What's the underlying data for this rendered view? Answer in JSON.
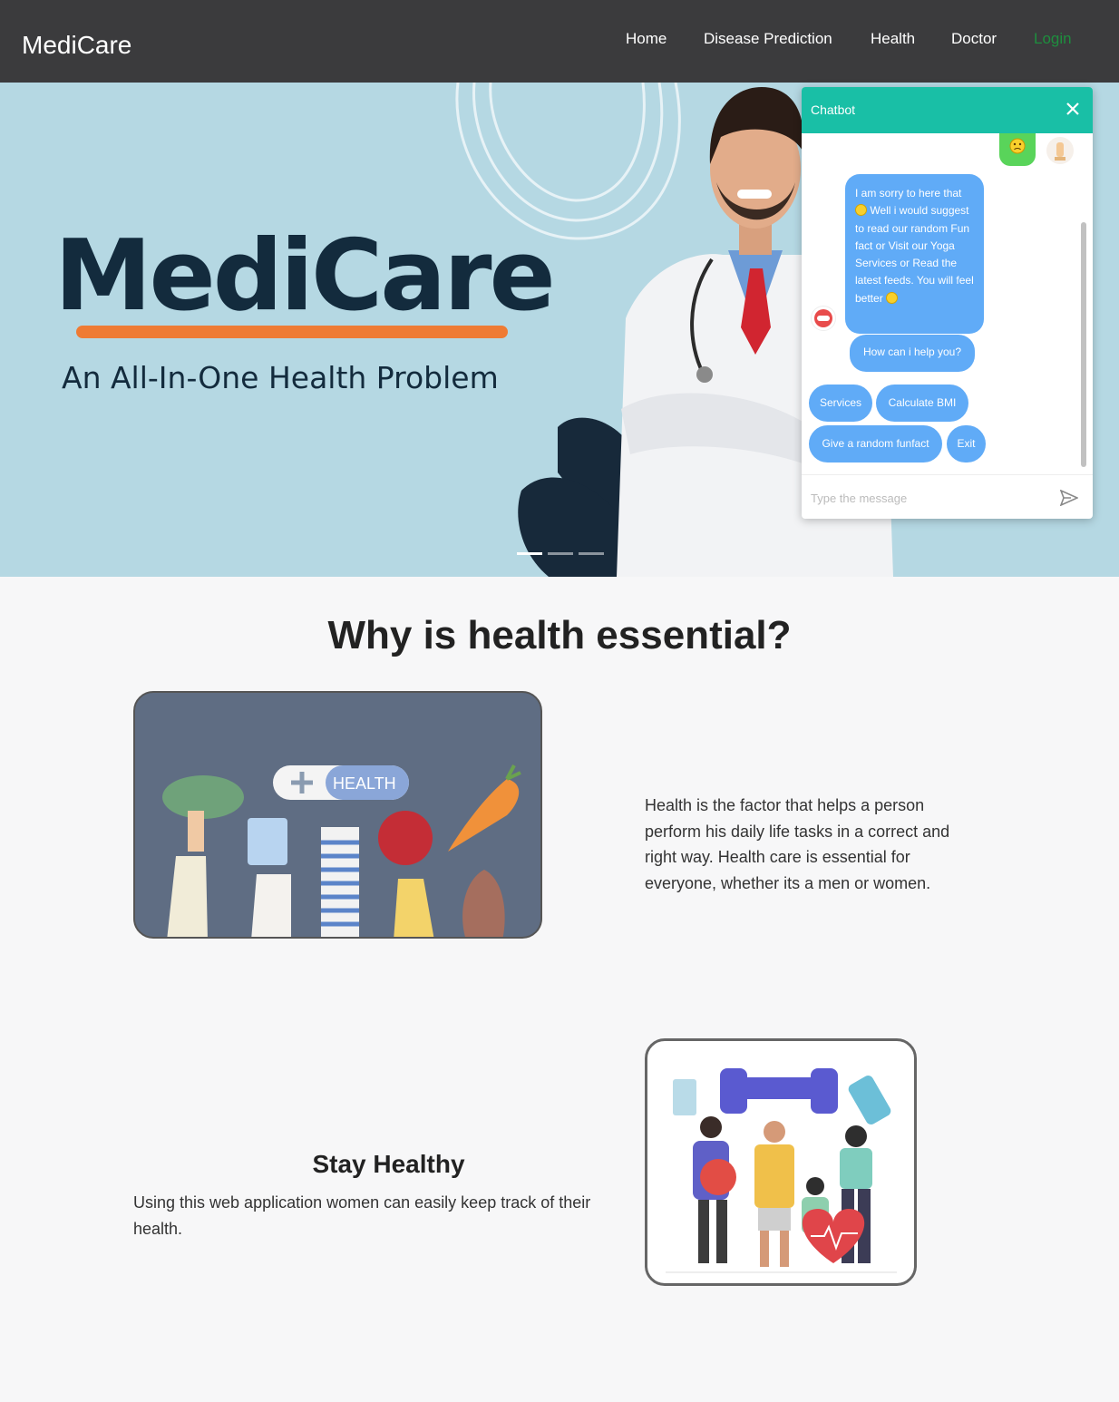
{
  "navbar": {
    "brand": "MediCare",
    "links": [
      "Home",
      "Disease Prediction",
      "Health",
      "Doctor"
    ],
    "login": "Login"
  },
  "hero": {
    "title": "MediCare",
    "subtitle": "An All-In-One Health Problem",
    "accent_color": "#ef7b34",
    "background_color": "#b5d8e3"
  },
  "chatbot": {
    "title": "Chatbot",
    "header_color": "#19bfa6",
    "bot_message_parts": [
      "I am sorry to here that ",
      " Well i would suggest to read our random Fun fact or Visit our Yoga Services or Read the latest feeds. You will feel better "
    ],
    "bot_question": "How can i help you?",
    "options": [
      "Services",
      "Calculate BMI",
      "Give a random funfact",
      "Exit"
    ],
    "input_placeholder": "Type the message",
    "icons": [
      "close-icon",
      "send-icon",
      "sad-emoji-icon",
      "smile-emoji-icon",
      "user-avatar-icon",
      "bot-avatar-icon"
    ]
  },
  "section": {
    "title": "Why is health essential?",
    "paragraph1": "Health is the factor that helps a person perform his daily life tasks in a correct and right way. Health care is essential for everyone, whether its a men or women.",
    "health_label": "HEALTH",
    "stay_title": "Stay Healthy",
    "paragraph2": "Using this web application women can easily keep track of their health."
  }
}
